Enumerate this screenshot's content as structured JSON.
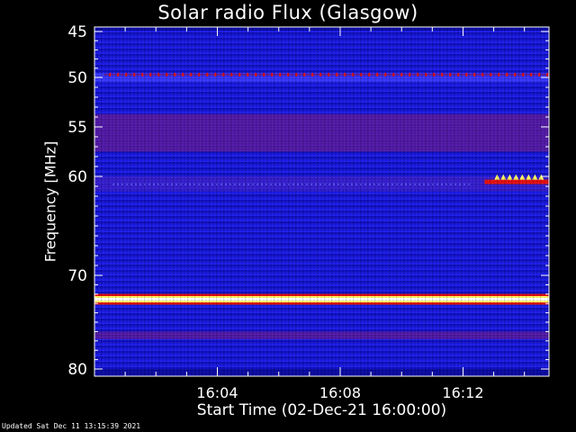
{
  "chart_data": {
    "type": "heatmap",
    "title": "Solar radio Flux (Glasgow)",
    "xlabel": "Start Time (02-Dec-21 16:00:00)",
    "ylabel": "Frequency [MHz]",
    "x_ticks": [
      "16:04",
      "16:08",
      "16:12"
    ],
    "x_tick_minutes": [
      4,
      8,
      12
    ],
    "xlim_minutes": [
      0,
      14.8
    ],
    "y_ticks": [
      45,
      50,
      55,
      60,
      70,
      80
    ],
    "ylim": [
      45,
      80
    ],
    "bands": [
      {
        "freq_from": 44.9,
        "freq_to": 49.5,
        "level": "blue"
      },
      {
        "freq_from": 49.5,
        "freq_to": 50.5,
        "level": "bright-blue"
      },
      {
        "freq_from": 50.5,
        "freq_to": 53.7,
        "level": "blue"
      },
      {
        "freq_from": 53.7,
        "freq_to": 57.5,
        "level": "violet"
      },
      {
        "freq_from": 57.5,
        "freq_to": 60.0,
        "level": "blue"
      },
      {
        "freq_from": 60.0,
        "freq_to": 61.5,
        "level": "indigo"
      },
      {
        "freq_from": 61.5,
        "freq_to": 72.2,
        "level": "blue"
      },
      {
        "freq_from": 72.2,
        "freq_to": 72.9,
        "level": "saturated"
      },
      {
        "freq_from": 72.9,
        "freq_to": 76.0,
        "level": "blue"
      },
      {
        "freq_from": 76.0,
        "freq_to": 76.8,
        "level": "violet"
      },
      {
        "freq_from": 76.8,
        "freq_to": 80.0,
        "level": "blue"
      }
    ],
    "colors": {
      "dark": "#0a0aa0",
      "blue": "#1c1ce6",
      "bright": "#3a3aff",
      "indigo": "#3a20c8",
      "violet": "#5a1a9a",
      "red": "#e01010",
      "yellow": "#ffff60",
      "white": "#ffffff"
    },
    "events": [
      {
        "name": "interference-line-50MHz",
        "freq": 49.7,
        "from": 0.3,
        "to": 14.8
      },
      {
        "name": "burst-60MHz",
        "freq": 60.6,
        "from": 12.7,
        "to": 14.8
      }
    ]
  },
  "footer": {
    "updated": "Updated Sat Dec 11 13:15:39 2021"
  }
}
